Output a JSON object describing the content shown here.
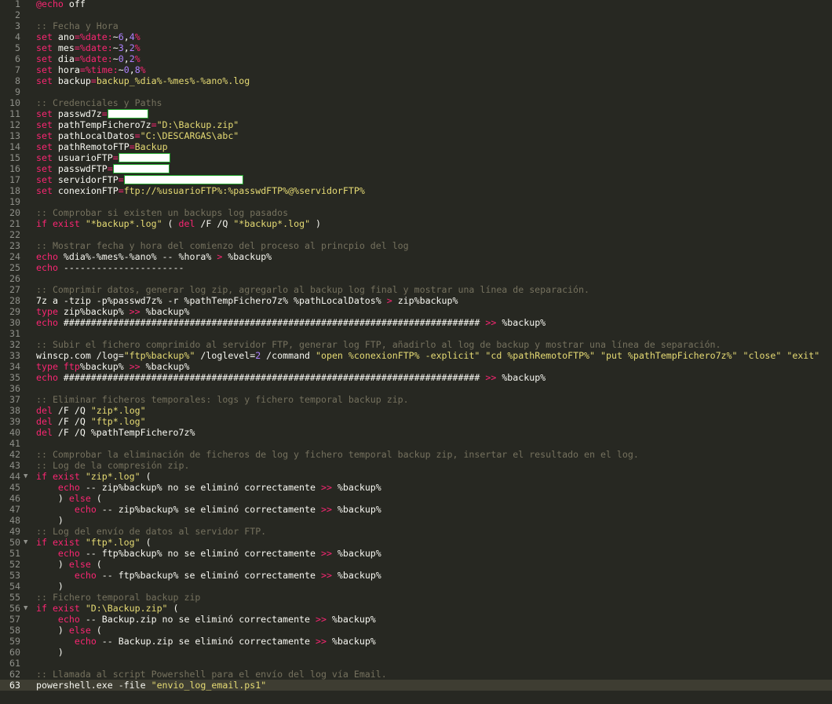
{
  "editor": {
    "language": "batch",
    "current_line": 63,
    "colors": {
      "background": "#272822",
      "keyword": "#f92672",
      "string": "#e6db74",
      "comment": "#75715e",
      "number": "#ae81ff",
      "text": "#f8f8f2",
      "redaction_border": "#1fa22a"
    },
    "lines": [
      {
        "n": "1",
        "tokens": [
          [
            "kw",
            "@echo"
          ],
          [
            "var",
            " off"
          ]
        ]
      },
      {
        "n": "2",
        "tokens": []
      },
      {
        "n": "3",
        "tokens": [
          [
            "cmt",
            ":: Fecha y Hora"
          ]
        ]
      },
      {
        "n": "4",
        "tokens": [
          [
            "kw",
            "set"
          ],
          [
            "var",
            " ano"
          ],
          [
            "op",
            "="
          ],
          [
            "kw",
            "%date:"
          ],
          [
            "var",
            "~"
          ],
          [
            "num",
            "6"
          ],
          [
            "var",
            ","
          ],
          [
            "num",
            "4"
          ],
          [
            "kw",
            "%"
          ]
        ]
      },
      {
        "n": "5",
        "tokens": [
          [
            "kw",
            "set"
          ],
          [
            "var",
            " mes"
          ],
          [
            "op",
            "="
          ],
          [
            "kw",
            "%date:"
          ],
          [
            "var",
            "~"
          ],
          [
            "num",
            "3"
          ],
          [
            "var",
            ","
          ],
          [
            "num",
            "2"
          ],
          [
            "kw",
            "%"
          ]
        ]
      },
      {
        "n": "6",
        "tokens": [
          [
            "kw",
            "set"
          ],
          [
            "var",
            " dia"
          ],
          [
            "op",
            "="
          ],
          [
            "kw",
            "%date:"
          ],
          [
            "var",
            "~"
          ],
          [
            "num",
            "0"
          ],
          [
            "var",
            ","
          ],
          [
            "num",
            "2"
          ],
          [
            "kw",
            "%"
          ]
        ]
      },
      {
        "n": "7",
        "tokens": [
          [
            "kw",
            "set"
          ],
          [
            "var",
            " hora"
          ],
          [
            "op",
            "="
          ],
          [
            "kw",
            "%time:"
          ],
          [
            "var",
            "~"
          ],
          [
            "num",
            "0"
          ],
          [
            "var",
            ","
          ],
          [
            "num",
            "8"
          ],
          [
            "kw",
            "%"
          ]
        ]
      },
      {
        "n": "8",
        "tokens": [
          [
            "kw",
            "set"
          ],
          [
            "var",
            " backup"
          ],
          [
            "op",
            "="
          ],
          [
            "str",
            "backup_%dia%-%mes%-%ano%.log"
          ]
        ]
      },
      {
        "n": "9",
        "tokens": []
      },
      {
        "n": "10",
        "tokens": [
          [
            "cmt",
            ":: Credenciales y Paths"
          ]
        ]
      },
      {
        "n": "11",
        "tokens": [
          [
            "kw",
            "set"
          ],
          [
            "var",
            " passwd7z"
          ],
          [
            "op",
            "="
          ],
          [
            "redact",
            "50"
          ]
        ]
      },
      {
        "n": "12",
        "tokens": [
          [
            "kw",
            "set"
          ],
          [
            "var",
            " pathTempFichero7z"
          ],
          [
            "op",
            "="
          ],
          [
            "str",
            "\"D:\\Backup.zip\""
          ]
        ]
      },
      {
        "n": "13",
        "tokens": [
          [
            "kw",
            "set"
          ],
          [
            "var",
            " pathLocalDatos"
          ],
          [
            "op",
            "="
          ],
          [
            "str",
            "\"C:\\DESCARGAS\\abc\""
          ]
        ]
      },
      {
        "n": "14",
        "tokens": [
          [
            "kw",
            "set"
          ],
          [
            "var",
            " pathRemotoFTP"
          ],
          [
            "op",
            "="
          ],
          [
            "str",
            "Backup"
          ]
        ]
      },
      {
        "n": "15",
        "tokens": [
          [
            "kw",
            "set"
          ],
          [
            "var",
            " usuarioFTP"
          ],
          [
            "op",
            "="
          ],
          [
            "redact",
            "64"
          ]
        ]
      },
      {
        "n": "16",
        "tokens": [
          [
            "kw",
            "set"
          ],
          [
            "var",
            " passwdFTP"
          ],
          [
            "op",
            "="
          ],
          [
            "redact",
            "70"
          ]
        ]
      },
      {
        "n": "17",
        "tokens": [
          [
            "kw",
            "set"
          ],
          [
            "var",
            " servidorFTP"
          ],
          [
            "op",
            "="
          ],
          [
            "redact",
            "150"
          ]
        ]
      },
      {
        "n": "18",
        "tokens": [
          [
            "kw",
            "set"
          ],
          [
            "var",
            " conexionFTP"
          ],
          [
            "op",
            "="
          ],
          [
            "str",
            "ftp://%usuarioFTP%:%passwdFTP%@%servidorFTP%"
          ]
        ]
      },
      {
        "n": "19",
        "tokens": []
      },
      {
        "n": "20",
        "tokens": [
          [
            "cmt",
            ":: Comprobar si existen un backups log pasados"
          ]
        ]
      },
      {
        "n": "21",
        "tokens": [
          [
            "kw",
            "if exist"
          ],
          [
            "str",
            " \"*backup*.log\""
          ],
          [
            "var",
            " ( "
          ],
          [
            "kw",
            "del"
          ],
          [
            "var",
            " /F /Q "
          ],
          [
            "str",
            "\"*backup*.log\""
          ],
          [
            "var",
            " )"
          ]
        ]
      },
      {
        "n": "22",
        "tokens": []
      },
      {
        "n": "23",
        "tokens": [
          [
            "cmt",
            ":: Mostrar fecha y hora del comienzo del proceso al princpio del log"
          ]
        ]
      },
      {
        "n": "24",
        "tokens": [
          [
            "kw",
            "echo"
          ],
          [
            "var",
            " %dia%-%mes%-%ano% -- %hora% "
          ],
          [
            "op",
            ">"
          ],
          [
            "var",
            " %backup%"
          ]
        ]
      },
      {
        "n": "25",
        "tokens": [
          [
            "kw",
            "echo"
          ],
          [
            "var",
            " ----------------------"
          ]
        ]
      },
      {
        "n": "26",
        "tokens": []
      },
      {
        "n": "27",
        "tokens": [
          [
            "cmt",
            ":: Comprimir datos, generar log zip, agregarlo al backup log final y mostrar una línea de separación."
          ]
        ]
      },
      {
        "n": "28",
        "tokens": [
          [
            "var",
            "7z a -tzip -p%passwd7z% -r %pathTempFichero7z% %pathLocalDatos% "
          ],
          [
            "op",
            ">"
          ],
          [
            "var",
            " zip%backup%"
          ]
        ]
      },
      {
        "n": "29",
        "tokens": [
          [
            "kw",
            "type"
          ],
          [
            "var",
            " zip%backup% "
          ],
          [
            "op",
            ">>"
          ],
          [
            "var",
            " %backup%"
          ]
        ]
      },
      {
        "n": "30",
        "tokens": [
          [
            "kw",
            "echo"
          ],
          [
            "var",
            " ############################################################################ "
          ],
          [
            "op",
            ">>"
          ],
          [
            "var",
            " %backup%"
          ]
        ]
      },
      {
        "n": "31",
        "tokens": []
      },
      {
        "n": "32",
        "tokens": [
          [
            "cmt",
            ":: Subir el fichero comprimido al servidor FTP, generar log FTP, añadirlo al log de backup y mostrar una línea de separación."
          ]
        ]
      },
      {
        "n": "33",
        "tokens": [
          [
            "var",
            "winscp.com /log="
          ],
          [
            "str",
            "\"ftp%backup%\""
          ],
          [
            "var",
            " /loglevel="
          ],
          [
            "num",
            "2"
          ],
          [
            "var",
            " /command "
          ],
          [
            "str",
            "\"open %conexionFTP% -explicit\""
          ],
          [
            "var",
            " "
          ],
          [
            "str",
            "\"cd %pathRemotoFTP%\""
          ],
          [
            "var",
            " "
          ],
          [
            "str",
            "\"put %pathTempFichero7z%\""
          ],
          [
            "var",
            " "
          ],
          [
            "str",
            "\"close\""
          ],
          [
            "var",
            " "
          ],
          [
            "str",
            "\"exit\""
          ]
        ]
      },
      {
        "n": "34",
        "tokens": [
          [
            "kw",
            "type"
          ],
          [
            "var",
            " "
          ],
          [
            "kw",
            "ftp"
          ],
          [
            "var",
            "%backup% "
          ],
          [
            "op",
            ">>"
          ],
          [
            "var",
            " %backup%"
          ]
        ]
      },
      {
        "n": "35",
        "tokens": [
          [
            "kw",
            "echo"
          ],
          [
            "var",
            " ############################################################################ "
          ],
          [
            "op",
            ">>"
          ],
          [
            "var",
            " %backup%"
          ]
        ]
      },
      {
        "n": "36",
        "tokens": []
      },
      {
        "n": "37",
        "tokens": [
          [
            "cmt",
            ":: Eliminar ficheros temporales: logs y fichero temporal backup zip."
          ]
        ]
      },
      {
        "n": "38",
        "tokens": [
          [
            "kw",
            "del"
          ],
          [
            "var",
            " /F /Q "
          ],
          [
            "str",
            "\"zip*.log\""
          ]
        ]
      },
      {
        "n": "39",
        "tokens": [
          [
            "kw",
            "del"
          ],
          [
            "var",
            " /F /Q "
          ],
          [
            "str",
            "\"ftp*.log\""
          ]
        ]
      },
      {
        "n": "40",
        "tokens": [
          [
            "kw",
            "del"
          ],
          [
            "var",
            " /F /Q %pathTempFichero7z%"
          ]
        ]
      },
      {
        "n": "41",
        "tokens": []
      },
      {
        "n": "42",
        "tokens": [
          [
            "cmt",
            ":: Comprobar la eliminación de ficheros de log y fichero temporal backup zip, insertar el resultado en el log."
          ]
        ]
      },
      {
        "n": "43",
        "tokens": [
          [
            "cmt",
            ":: Log de la compresión zip."
          ]
        ]
      },
      {
        "n": "44",
        "fold": true,
        "tokens": [
          [
            "kw",
            "if exist"
          ],
          [
            "str",
            " \"zip*.log\""
          ],
          [
            "var",
            " ("
          ]
        ]
      },
      {
        "n": "45",
        "tokens": [
          [
            "var",
            "    "
          ],
          [
            "kw",
            "echo"
          ],
          [
            "var",
            " -- zip%backup% no se eliminó correctamente "
          ],
          [
            "op",
            ">>"
          ],
          [
            "var",
            " %backup%"
          ]
        ]
      },
      {
        "n": "46",
        "tokens": [
          [
            "var",
            "    ) "
          ],
          [
            "kw",
            "else"
          ],
          [
            "var",
            " ("
          ]
        ]
      },
      {
        "n": "47",
        "tokens": [
          [
            "var",
            "       "
          ],
          [
            "kw",
            "echo"
          ],
          [
            "var",
            " -- zip%backup% se eliminó correctamente "
          ],
          [
            "op",
            ">>"
          ],
          [
            "var",
            " %backup%"
          ]
        ]
      },
      {
        "n": "48",
        "tokens": [
          [
            "var",
            "    )"
          ]
        ]
      },
      {
        "n": "49",
        "tokens": [
          [
            "cmt",
            ":: Log del envío de datos al servidor FTP."
          ]
        ]
      },
      {
        "n": "50",
        "fold": true,
        "tokens": [
          [
            "kw",
            "if exist"
          ],
          [
            "str",
            " \"ftp*.log\""
          ],
          [
            "var",
            " ("
          ]
        ]
      },
      {
        "n": "51",
        "tokens": [
          [
            "var",
            "    "
          ],
          [
            "kw",
            "echo"
          ],
          [
            "var",
            " -- ftp%backup% no se eliminó correctamente "
          ],
          [
            "op",
            ">>"
          ],
          [
            "var",
            " %backup%"
          ]
        ]
      },
      {
        "n": "52",
        "tokens": [
          [
            "var",
            "    ) "
          ],
          [
            "kw",
            "else"
          ],
          [
            "var",
            " ("
          ]
        ]
      },
      {
        "n": "53",
        "tokens": [
          [
            "var",
            "       "
          ],
          [
            "kw",
            "echo"
          ],
          [
            "var",
            " -- ftp%backup% se eliminó correctamente "
          ],
          [
            "op",
            ">>"
          ],
          [
            "var",
            " %backup%"
          ]
        ]
      },
      {
        "n": "54",
        "tokens": [
          [
            "var",
            "    )"
          ]
        ]
      },
      {
        "n": "55",
        "tokens": [
          [
            "cmt",
            ":: Fichero temporal backup zip"
          ]
        ]
      },
      {
        "n": "56",
        "fold": true,
        "tokens": [
          [
            "kw",
            "if exist"
          ],
          [
            "str",
            " \"D:\\Backup.zip\""
          ],
          [
            "var",
            " ("
          ]
        ]
      },
      {
        "n": "57",
        "tokens": [
          [
            "var",
            "    "
          ],
          [
            "kw",
            "echo"
          ],
          [
            "var",
            " -- Backup.zip no se eliminó correctamente "
          ],
          [
            "op",
            ">>"
          ],
          [
            "var",
            " %backup%"
          ]
        ]
      },
      {
        "n": "58",
        "tokens": [
          [
            "var",
            "    ) "
          ],
          [
            "kw",
            "else"
          ],
          [
            "var",
            " ("
          ]
        ]
      },
      {
        "n": "59",
        "tokens": [
          [
            "var",
            "       "
          ],
          [
            "kw",
            "echo"
          ],
          [
            "var",
            " -- Backup.zip se eliminó correctamente "
          ],
          [
            "op",
            ">>"
          ],
          [
            "var",
            " %backup%"
          ]
        ]
      },
      {
        "n": "60",
        "tokens": [
          [
            "var",
            "    )"
          ]
        ]
      },
      {
        "n": "61",
        "tokens": []
      },
      {
        "n": "62",
        "tokens": [
          [
            "cmt",
            ":: Llamada al script Powershell para el envío del log vía Email."
          ]
        ]
      },
      {
        "n": "63",
        "tokens": [
          [
            "var",
            "powershell.exe -file "
          ],
          [
            "str",
            "\"envio_log_email.ps1\""
          ]
        ]
      }
    ]
  }
}
